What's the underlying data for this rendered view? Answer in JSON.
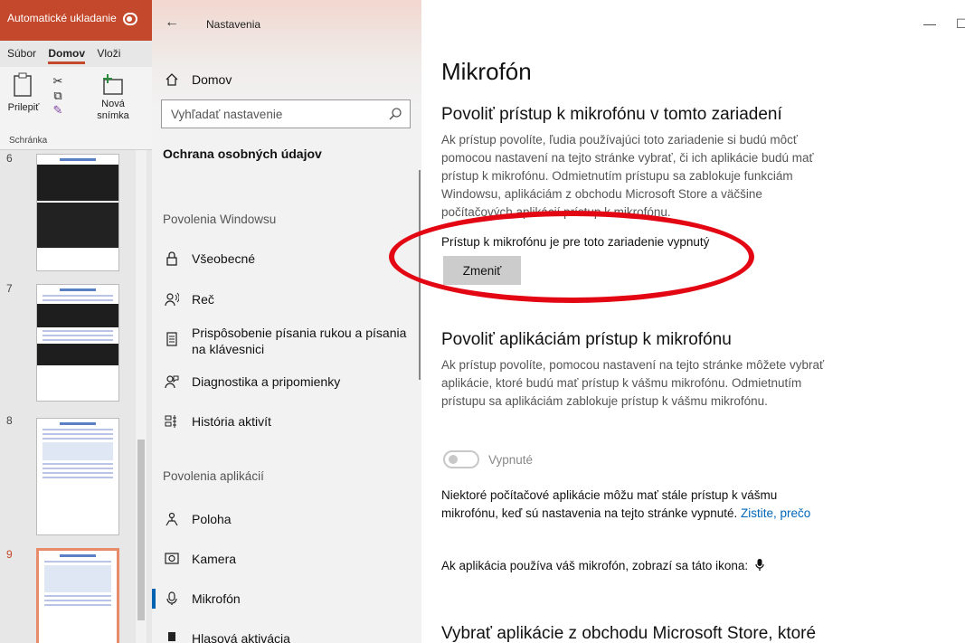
{
  "ppt": {
    "autosave": "Automatické ukladanie",
    "tabs": [
      "Súbor",
      "Domov",
      "Vloži"
    ],
    "paste": "Prilepiť",
    "new_slide": "Nová snímka",
    "group": "Schránka",
    "slide_numbers": [
      "6",
      "7",
      "8",
      "9"
    ]
  },
  "settings": {
    "app_title": "Nastavenia",
    "home": "Domov",
    "search_placeholder": "Vyhľadať nastavenie",
    "section": "Ochrana osobných údajov",
    "group_windows": "Povolenia Windowsu",
    "group_apps": "Povolenia aplikácií",
    "nav": [
      {
        "label": "Všeobecné",
        "icon": "lock-icon"
      },
      {
        "label": "Reč",
        "icon": "speech-icon"
      },
      {
        "label": "Prispôsobenie písania rukou a písania na klávesnici",
        "icon": "inking-icon"
      },
      {
        "label": "Diagnostika a pripomienky",
        "icon": "feedback-icon"
      },
      {
        "label": "História aktivít",
        "icon": "timeline-icon"
      },
      {
        "label": "Poloha",
        "icon": "location-icon"
      },
      {
        "label": "Kamera",
        "icon": "camera-icon"
      },
      {
        "label": "Mikrofón",
        "icon": "microphone-icon",
        "active": true
      },
      {
        "label": "Hlasová aktivácia",
        "icon": "voice-icon"
      }
    ]
  },
  "content": {
    "title": "Mikrofón",
    "device_heading": "Povoliť prístup k mikrofónu v tomto zariadení",
    "device_desc": "Ak prístup povolíte, ľudia používajúci toto zariadenie si budú môcť pomocou nastavení na tejto stránke vybrať, či ich aplikácie budú mať prístup k mikrofónu. Odmietnutím prístupu sa zablokuje funkciám Windowsu, aplikáciám z obchodu Microsoft Store a väčšine počítačových aplikácií prístup k mikrofónu.",
    "device_status": "Prístup k mikrofónu je pre toto zariadenie vypnutý",
    "change_button": "Zmeniť",
    "apps_heading": "Povoliť aplikáciám prístup k mikrofónu",
    "apps_desc": "Ak prístup povolíte, pomocou nastavení na tejto stránke môžete vybrať aplikácie, ktoré budú mať prístup k vášmu mikrofónu. Odmietnutím prístupu sa aplikáciám zablokuje prístup k vášmu mikrofónu.",
    "toggle_label": "Vypnuté",
    "toggle_on": false,
    "desktop_note": "Niektoré počítačové aplikácie môžu mať stále prístup k vášmu mikrofónu, keď sú nastavenia na tejto stránke vypnuté.",
    "learn_why": "Zistite, prečo",
    "icon_note": "Ak aplikácia používa váš mikrofón, zobrazí sa táto ikona:",
    "store_heading": "Vybrať aplikácie z obchodu Microsoft Store, ktoré"
  },
  "colors": {
    "accent": "#0063b1",
    "annotation_ring": "#e30613",
    "ppt_brand": "#c4482c"
  }
}
